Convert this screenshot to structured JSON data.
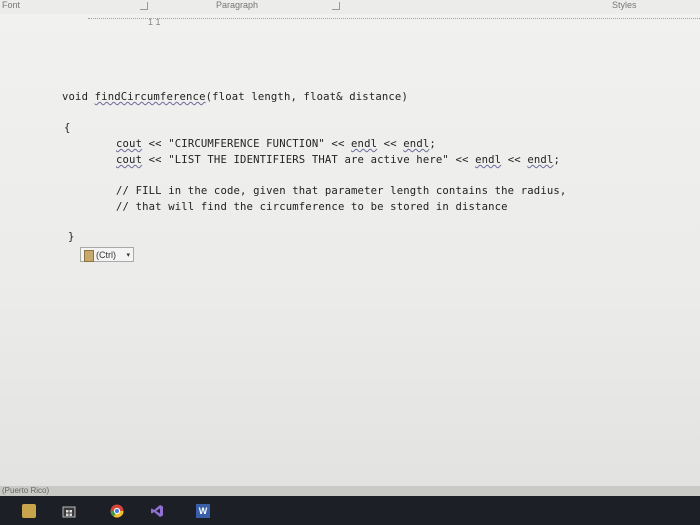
{
  "ribbon": {
    "font_label": "Font",
    "paragraph_label": "Paragraph",
    "styles_label": "Styles"
  },
  "ruler": {
    "mark": "1 1"
  },
  "code": {
    "line1_pre": "void ",
    "line1_fn": "findCircumference",
    "line1_post": "(float length, float& distance)",
    "open_brace": "{",
    "line2_cout": "cout",
    "line2_mid": " << \"CIRCUMFERENCE FUNCTION\" << ",
    "line2_endl1": "endl",
    "line2_sep": " << ",
    "line2_endl2": "endl",
    "line2_end": ";",
    "line3_cout": "cout",
    "line3_mid": " << \"LIST THE IDENTIFIERS THAT are active here\" << ",
    "line3_endl1": "endl",
    "line3_sep": " << ",
    "line3_endl2": "endl",
    "line3_end": ";",
    "comment1": "// FILL in the code, given that parameter length contains the radius,",
    "comment2": "// that will find the circumference to be stored in distance",
    "close_brace": "}"
  },
  "paste_options": {
    "label": "(Ctrl)",
    "arrow": "▾"
  },
  "status_bar": {
    "language": "(Puerto Rico)"
  },
  "taskbar": {
    "word_label": "W"
  },
  "colors": {
    "taskbar": "#1c1f26",
    "page": "#efefed"
  }
}
